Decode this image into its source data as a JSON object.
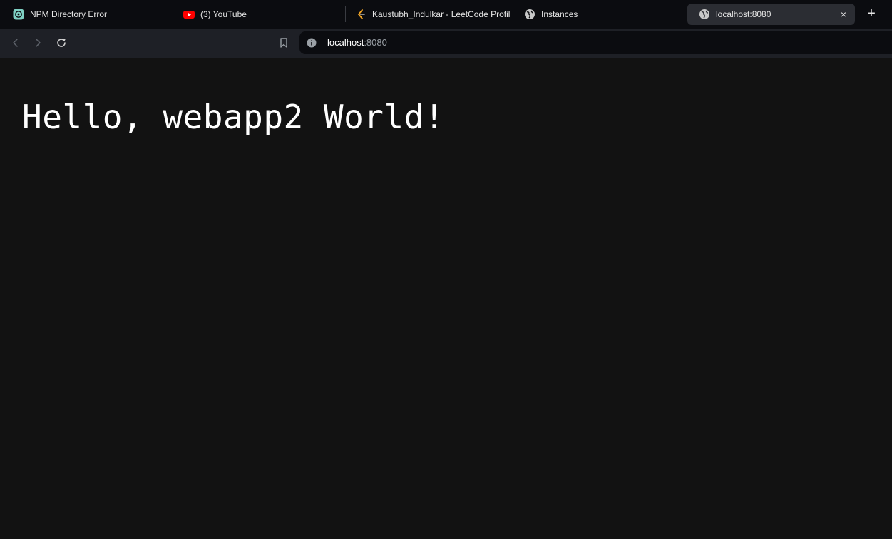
{
  "tabs": [
    {
      "title": "NPM Directory Error",
      "icon": "chatgpt-icon"
    },
    {
      "title": "(3) YouTube",
      "icon": "youtube-icon"
    },
    {
      "title": "Kaustubh_Indulkar - LeetCode Profile",
      "icon": "leetcode-icon"
    },
    {
      "title": "Instances",
      "icon": "globe-icon"
    },
    {
      "title": "localhost:8080",
      "icon": "globe-icon",
      "active": true
    }
  ],
  "new_tab_label": "+",
  "close_label": "×",
  "address": {
    "host": "localhost",
    "port": ":8080"
  },
  "page": {
    "heading": "Hello, webapp2 World!"
  },
  "colors": {
    "tabbar_bg": "#0b0c10",
    "toolbar_bg": "#1e2026",
    "page_bg": "#121212",
    "youtube_red": "#ff0000",
    "chatgpt_teal": "#7fd1c4",
    "leetcode_orange": "#f5a623"
  }
}
